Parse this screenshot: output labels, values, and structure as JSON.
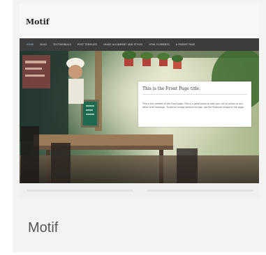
{
  "theme_card": {
    "name": "Motif"
  },
  "preview": {
    "site_title": "Motif",
    "nav": [
      "HOME",
      "BLOG",
      "TESTIMONIALS",
      "POST TEMPLATE",
      "IMAGE ALIGNMENT AND STYLES",
      "HTML ELEMENTS",
      "A PARENT PAGE"
    ],
    "hero_caption": {
      "title": "This is the Front Page title.",
      "body": "This is the content of the Front page. This is a great place to add your call to action or any other brief message. To add an image behind the box, use the Featured Image of the page."
    }
  },
  "colors": {
    "nav_background": "#3d3d3d",
    "card_background": "#f3f3f3"
  }
}
